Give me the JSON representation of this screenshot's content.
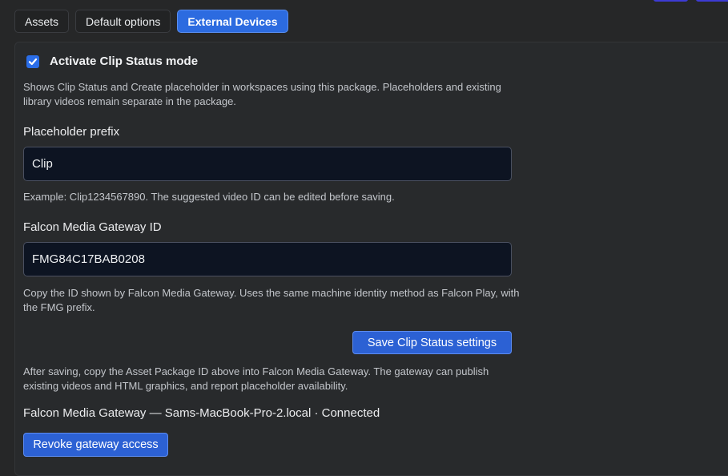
{
  "tabs": [
    {
      "label": "Assets"
    },
    {
      "label": "Default options"
    },
    {
      "label": "External Devices"
    }
  ],
  "clip_status": {
    "checkbox_label": "Activate Clip Status mode",
    "checked": true,
    "description": "Shows Clip Status and Create placeholder in workspaces using this package. Placeholders and existing library videos remain separate in the package."
  },
  "placeholder": {
    "label": "Placeholder prefix",
    "value": "Clip",
    "help": "Example: Clip1234567890. The suggested video ID can be edited before saving."
  },
  "gateway": {
    "label": "Falcon Media Gateway ID",
    "value": "FMG84C17BAB0208",
    "help": "Copy the ID shown by Falcon Media Gateway. Uses the same machine identity method as Falcon Play, with the FMG prefix."
  },
  "save_button": "Save Clip Status settings",
  "after_save_note": "After saving, copy the Asset Package ID above into Falcon Media Gateway. The gateway can publish existing videos and HTML graphics, and report placeholder availability.",
  "connection_status": "Falcon Media Gateway — Sams-MacBook-Pro-2.local · Connected",
  "revoke_button": "Revoke gateway access",
  "colors": {
    "accent": "#2c6be0",
    "input_bg": "#0d1422",
    "background": "#262728"
  },
  "icons": {
    "checkbox": "checkmark-icon"
  }
}
